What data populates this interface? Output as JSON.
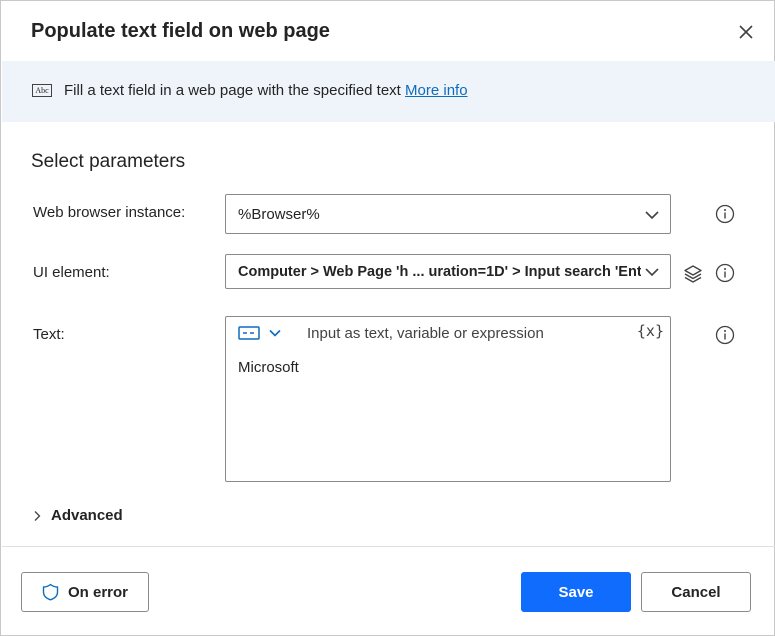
{
  "dialog": {
    "title": "Populate text field on web page"
  },
  "banner": {
    "icon": "abc-text-icon",
    "icon_text": "Abc",
    "description": "Fill a text field in a web page with the specified text",
    "link_text": "More info"
  },
  "section": {
    "title": "Select parameters"
  },
  "params": {
    "browser": {
      "label": "Web browser instance:",
      "value": "%Browser%"
    },
    "ui_element": {
      "label": "UI element:",
      "value": "Computer > Web Page 'h ... uration=1D' > Input search 'Ent"
    },
    "text": {
      "label": "Text:",
      "placeholder": "Input as text, variable or expression",
      "fx_label": "{x}",
      "value": "Microsoft"
    }
  },
  "advanced": {
    "label": "Advanced"
  },
  "footer": {
    "on_error_label": "On error",
    "save_label": "Save",
    "cancel_label": "Cancel"
  },
  "colors": {
    "accent": "#0f6cfd",
    "link": "#0f6cbd",
    "banner_bg": "#eff4fb"
  }
}
